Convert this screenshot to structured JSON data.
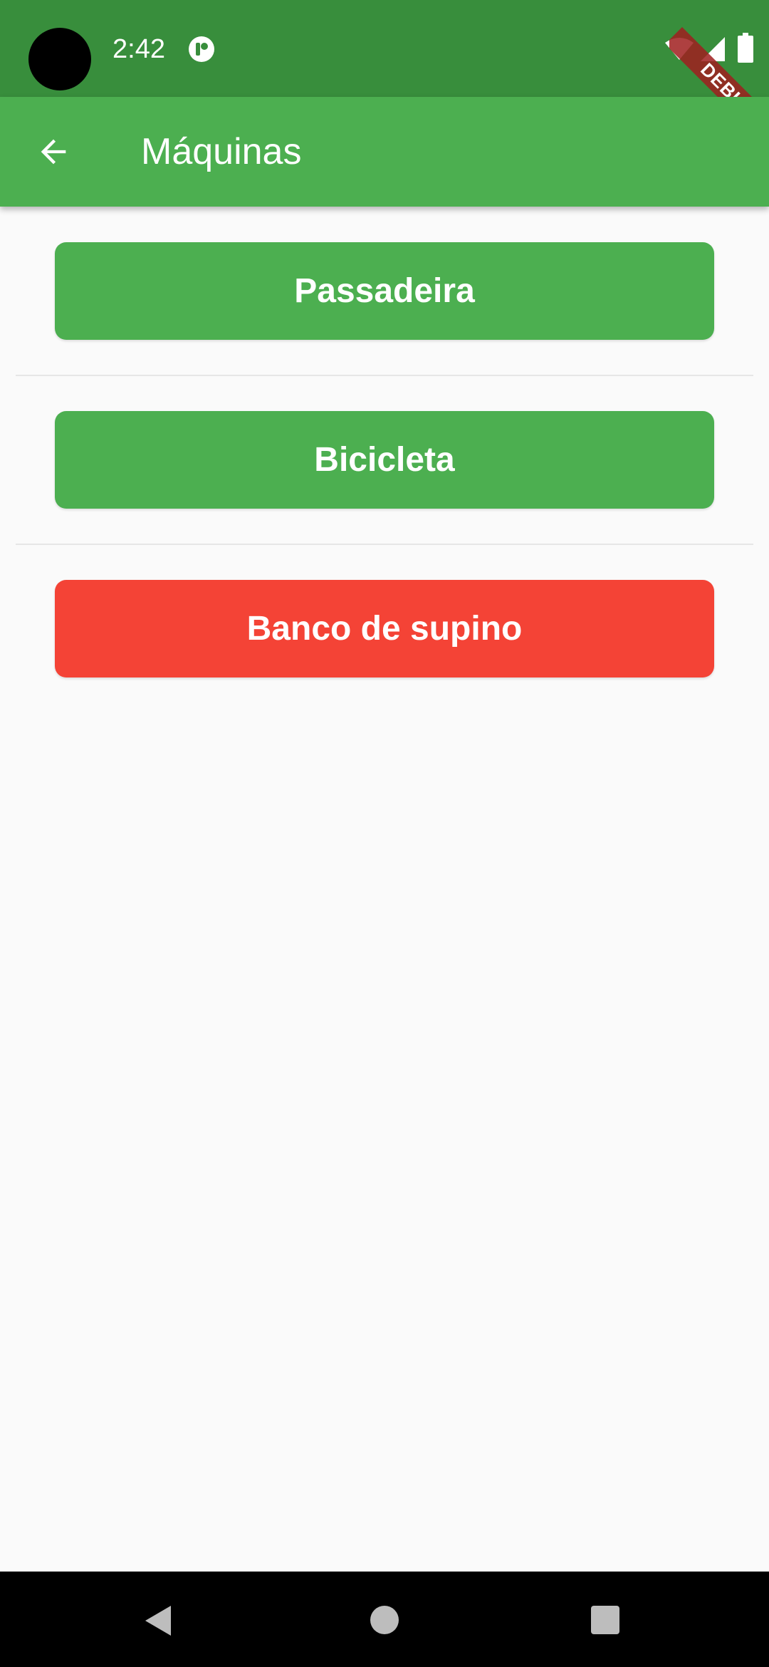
{
  "status_bar": {
    "time": "2:42",
    "background_color": "#388e3c",
    "icons": [
      "notification-icon",
      "wifi-icon",
      "signal-icon",
      "battery-icon"
    ]
  },
  "debug_banner": {
    "label": "DEBUG"
  },
  "app_bar": {
    "title": "Máquinas",
    "back_icon": "arrow-back-icon",
    "background_color": "#4caf50"
  },
  "machines": [
    {
      "label": "Passadeira",
      "color": "#4caf50"
    },
    {
      "label": "Bicicleta",
      "color": "#4caf50"
    },
    {
      "label": "Banco de supino",
      "color": "#f44336"
    }
  ],
  "nav_bar": {
    "icons": [
      "nav-back-icon",
      "nav-home-icon",
      "nav-recents-icon"
    ]
  }
}
